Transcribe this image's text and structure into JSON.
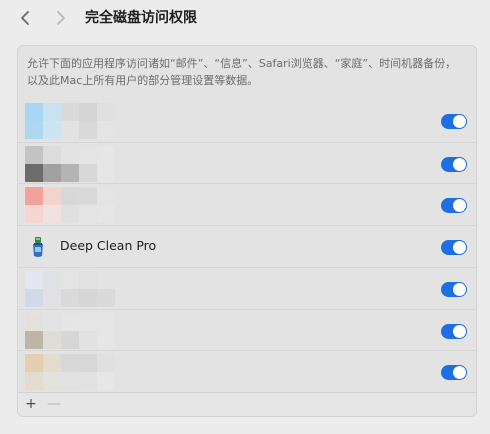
{
  "header": {
    "title": "完全磁盘访问权限",
    "back_icon": "chevron-left-icon",
    "forward_icon": "chevron-right-icon"
  },
  "panel": {
    "description": "允许下面的应用程序访问诸如“邮件”、“信息”、Safari浏览器、“家庭”、时间机器备份，以及此Mac上所有用户的部分管理设置等数据。",
    "apps": [
      {
        "name": "",
        "blurred": true,
        "enabled": true,
        "pixels": [
          [
            "#a9d6f2",
            "#c8e2f2",
            "#dadada",
            "#d4d4d4",
            "#e0e0e0"
          ],
          [
            "#aed8f2",
            "#cce4f3",
            "#e2e2e2",
            "#d9d9d9",
            "#e4e4e4"
          ]
        ]
      },
      {
        "name": "",
        "blurred": true,
        "enabled": true,
        "pixels": [
          [
            "#c3c3c3",
            "#dcdcdc",
            "#e3e3e3",
            "#e4e4e4",
            "#e6e6e6"
          ],
          [
            "#6c6c6c",
            "#a1a1a1",
            "#b4b4b4",
            "#d8d8d8",
            "#e6e6e6"
          ]
        ]
      },
      {
        "name": "",
        "blurred": true,
        "enabled": true,
        "pixels": [
          [
            "#f3a299",
            "#f2d3cf",
            "#d7d7d7",
            "#d9d9d9",
            "#e4e4e4"
          ],
          [
            "#f6d6d2",
            "#f1e2e0",
            "#e0e0e0",
            "#e4e4e4",
            "#e6e6e6"
          ]
        ]
      },
      {
        "name": "Deep Clean Pro",
        "blurred": false,
        "enabled": true,
        "icon": "broom-app-icon"
      },
      {
        "name": "",
        "blurred": true,
        "enabled": true,
        "pixels": [
          [
            "#e3e6ee",
            "#dfe1e6",
            "#e4e4e4",
            "#e1e1e1",
            "#e3e3e3"
          ],
          [
            "#d2d9ea",
            "#e1e1e3",
            "#d9d9d9",
            "#d6d6d6",
            "#dadada"
          ]
        ]
      },
      {
        "name": "",
        "blurred": true,
        "enabled": true,
        "pixels": [
          [
            "#e2e1dc",
            "#e3e3e3",
            "#e5e5e5",
            "#e6e6e6",
            "#e6e6e6"
          ],
          [
            "#bdb5a8",
            "#dedcd6",
            "#d6d6d6",
            "#e2e2e2",
            "#e6e6e6"
          ]
        ]
      },
      {
        "name": "",
        "blurred": true,
        "enabled": true,
        "pixels": [
          [
            "#e4cfae",
            "#e2dccf",
            "#d7d7d7",
            "#d7d7d7",
            "#e0e0e0"
          ],
          [
            "#e2dbcf",
            "#e3e1dc",
            "#e1e1e1",
            "#e2e2e2",
            "#e6e6e6"
          ]
        ]
      }
    ],
    "toggle_color": "#1f6fe4",
    "add_label": "+",
    "remove_label": "—"
  }
}
